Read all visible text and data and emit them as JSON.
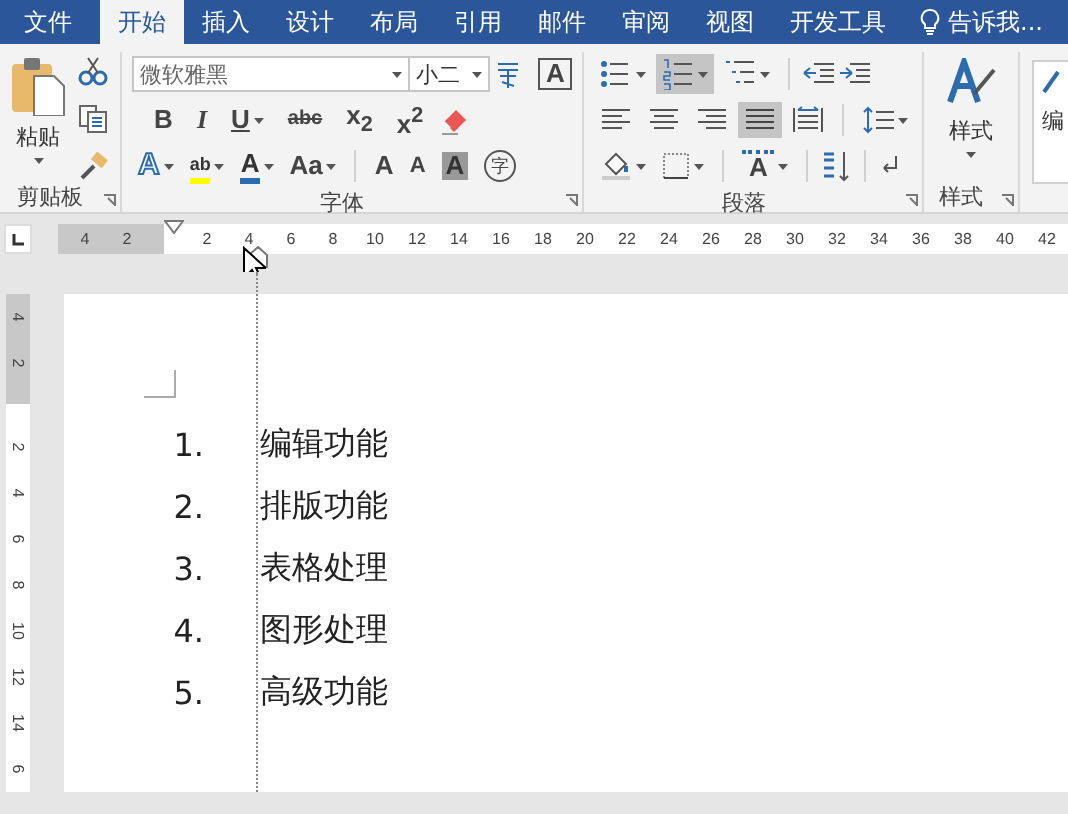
{
  "tabs": [
    {
      "label": "文件",
      "selected": false
    },
    {
      "label": "开始",
      "selected": true
    },
    {
      "label": "插入",
      "selected": false
    },
    {
      "label": "设计",
      "selected": false
    },
    {
      "label": "布局",
      "selected": false
    },
    {
      "label": "引用",
      "selected": false
    },
    {
      "label": "邮件",
      "selected": false
    },
    {
      "label": "审阅",
      "selected": false
    },
    {
      "label": "视图",
      "selected": false
    },
    {
      "label": "开发工具",
      "selected": false
    }
  ],
  "tell_me": "告诉我...",
  "ribbon": {
    "clipboard": {
      "paste_label": "粘贴",
      "group_label": "剪贴板"
    },
    "font": {
      "font_name": "微软雅黑",
      "font_size": "小二",
      "border_glyph": "A",
      "format_buttons": [
        {
          "kind": "bold",
          "glyph": "B"
        },
        {
          "kind": "italic",
          "glyph": "I"
        },
        {
          "kind": "underline",
          "glyph": "U"
        },
        {
          "kind": "strike",
          "glyph": "abc"
        },
        {
          "kind": "sub",
          "glyph": "x$_{2}$"
        },
        {
          "kind": "sup",
          "glyph": "x$^{2}$"
        }
      ],
      "effect_buttons": [
        {
          "kind": "text_effect",
          "glyph": "A"
        },
        {
          "kind": "highlight",
          "glyph": "ab"
        },
        {
          "kind": "font_color",
          "glyph": "A"
        },
        {
          "kind": "case",
          "glyph": "Aa"
        },
        {
          "kind": "grow",
          "glyph": "A"
        },
        {
          "kind": "shrink",
          "glyph": "A"
        },
        {
          "kind": "shading",
          "glyph": "A"
        },
        {
          "kind": "enclose",
          "glyph": "字"
        }
      ],
      "group_label": "字体"
    },
    "paragraph": {
      "list_buttons": [
        {
          "kind": "bullets",
          "selected": false
        },
        {
          "kind": "numbering",
          "selected": true
        },
        {
          "kind": "multilevel",
          "selected": false
        }
      ],
      "align_buttons": [
        {
          "kind": "left",
          "selected": false
        },
        {
          "kind": "center",
          "selected": false
        },
        {
          "kind": "right",
          "selected": false
        },
        {
          "kind": "justify",
          "selected": true
        },
        {
          "kind": "distributed",
          "selected": false
        }
      ],
      "layout_glyph": "A",
      "group_label": "段落"
    },
    "styles": {
      "button_label": "样式",
      "group_label": "样式"
    },
    "editing": {
      "button_label": "编"
    }
  },
  "ruler": {
    "left_numbers": [
      "4",
      "2"
    ],
    "numbers": [
      "2",
      "4",
      "6",
      "8",
      "10",
      "12",
      "14",
      "16",
      "18",
      "20",
      "22",
      "24",
      "26",
      "28",
      "30",
      "32",
      "34",
      "36",
      "38",
      "40",
      "42"
    ]
  },
  "vertical_ruler": {
    "top_numbers": [
      "4",
      "2"
    ],
    "numbers": [
      "2",
      "4",
      "6",
      "8",
      "10",
      "12",
      "14",
      "6"
    ]
  },
  "list": [
    {
      "number": "1.",
      "text": "编辑功能"
    },
    {
      "number": "2.",
      "text": "排版功能"
    },
    {
      "number": "3.",
      "text": "表格处理"
    },
    {
      "number": "4.",
      "text": "图形处理"
    },
    {
      "number": "5.",
      "text": "高级功能"
    }
  ]
}
